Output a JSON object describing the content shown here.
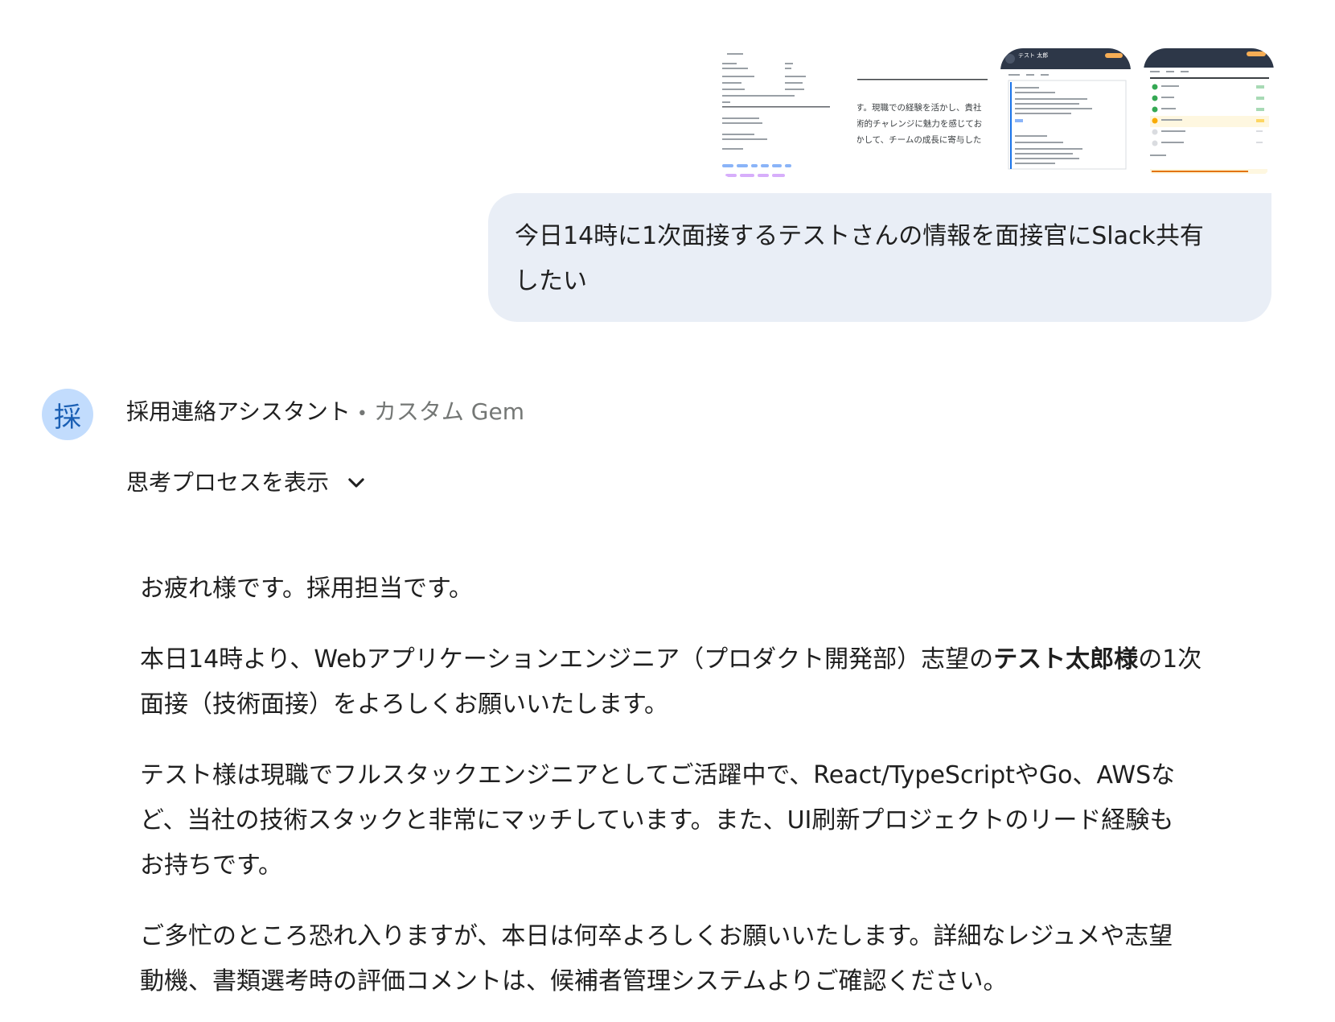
{
  "attachments": [
    {
      "name": "attachment-thumb-1",
      "kind": "profile-form"
    },
    {
      "name": "attachment-thumb-2",
      "kind": "text-excerpt",
      "lines": [
        "す。現職での経験を活かし、貴社",
        "術的チャレンジに魅力を感じてお",
        "かして、チームの成長に寄与した"
      ]
    },
    {
      "name": "attachment-thumb-3",
      "kind": "candidate-detail",
      "title": "テスト 太郎"
    },
    {
      "name": "attachment-thumb-4",
      "kind": "candidate-list"
    }
  ],
  "user_message": {
    "line1": "今日14時に1次面接するテストさんの情報を面接官にSlack共有",
    "line2": "したい"
  },
  "assistant": {
    "avatar_char": "採",
    "name": "採用連絡アシスタント",
    "separator": "•",
    "type": "カスタム Gem",
    "thinking_label": "思考プロセスを表示",
    "chevron_icon": "chevron-down-icon"
  },
  "response": {
    "p1": "お疲れ様です。採用担当です。",
    "p2_a": "本日14時より、Webアプリケーションエンジニア（プロダクト開発部）志望の",
    "p2_bold": "テスト太郎様",
    "p2_b": "の1次",
    "p2_c": "面接（技術面接）をよろしくお願いいたします。",
    "p3_l1": "テスト様は現職でフルスタックエンジニアとしてご活躍中で、React/TypeScriptやGo、AWSな",
    "p3_l2": "ど、当社の技術スタックと非常にマッチしています。また、UI刷新プロジェクトのリード経験も",
    "p3_l3": "お持ちです。",
    "p4_l1": "ご多忙のところ恐れ入りますが、本日は何卒よろしくお願いいたします。詳細なレジュメや志望",
    "p4_l2": "動機、書類選考時の評価コメントは、候補者管理システムよりご確認ください。"
  }
}
